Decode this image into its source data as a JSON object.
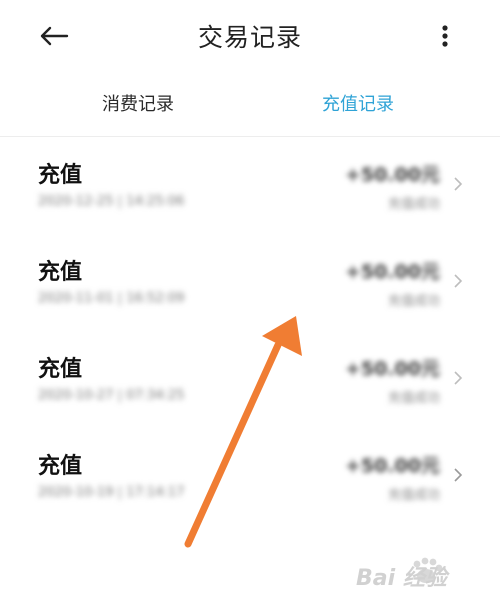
{
  "header": {
    "title": "交易记录",
    "back_icon": "arrow-left-icon",
    "more_icon": "more-vertical-icon"
  },
  "tabs": [
    {
      "label": "消费记录",
      "active": false
    },
    {
      "label": "充值记录",
      "active": true
    }
  ],
  "colors": {
    "accent": "#2fa3d6",
    "annotation_arrow": "#f07d33"
  },
  "records": [
    {
      "type": "充值",
      "time": "2020-12-25 | 14:25:06",
      "amount": "+50.00元",
      "status": "充值成功"
    },
    {
      "type": "充值",
      "time": "2020-11-01 | 16:52:09",
      "amount": "+50.00元",
      "status": "充值成功"
    },
    {
      "type": "充值",
      "time": "2020-10-27 | 07:34:25",
      "amount": "+50.00元",
      "status": "充值成功"
    },
    {
      "type": "充值",
      "time": "2020-10-19 | 17:14:17",
      "amount": "+50.00元",
      "status": "充值成功"
    }
  ],
  "watermark": {
    "text": "Bai 经验"
  }
}
